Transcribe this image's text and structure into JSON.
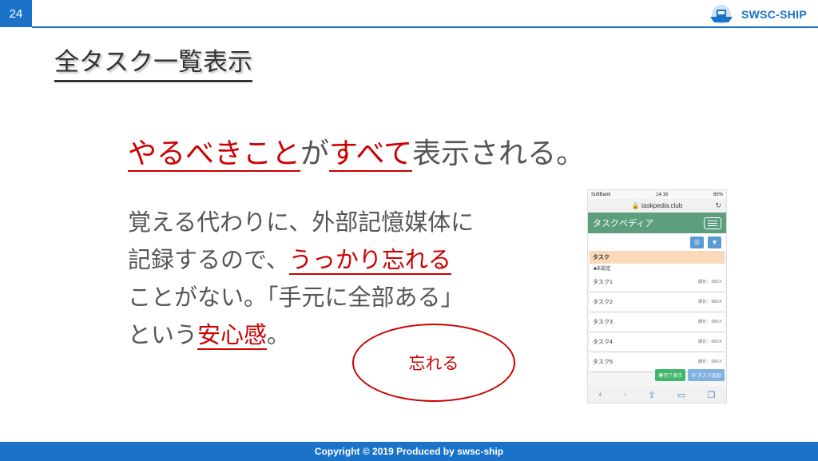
{
  "page_number": "24",
  "logo": {
    "text": "SWSC-SHIP",
    "icon": "ship-icon"
  },
  "title": "全タスク一覧表示",
  "headline": {
    "part1": "やるべきこと",
    "part2": "が",
    "part3": "すべて",
    "part4": "表示される。"
  },
  "body": {
    "line1": "覚える代わりに、外部記憶媒体に",
    "line2_a": "記録するので、",
    "line2_b": "うっかり忘れる",
    "line3": "ことがない。「手元に全部ある」",
    "line4_a": "という",
    "line4_b": "安心感",
    "line4_c": "。"
  },
  "ellipse_label": "忘れる",
  "phone": {
    "carrier": "SoftBank",
    "time": "14:16",
    "battery": "65%",
    "url": "taskpedia.club",
    "app_title": "タスクペディア",
    "list_header": "タスク",
    "section": "■未設定",
    "tasks": [
      {
        "name": "タスク1",
        "due": "期日： 08/14"
      },
      {
        "name": "タスク2",
        "due": "期日： 08/14"
      },
      {
        "name": "タスク3",
        "due": "期日： 08/14"
      },
      {
        "name": "タスク4",
        "due": "期日： 08/14"
      },
      {
        "name": "タスク5",
        "due": "期日： 08/14"
      }
    ],
    "done_button": "完了表示",
    "add_button": "タスク追加"
  },
  "footer": "Copyright © 2019 Produced by swsc-ship",
  "colors": {
    "brand_blue": "#1a73c9",
    "accent_red": "#cc0000",
    "app_green": "#5d9e7e"
  }
}
